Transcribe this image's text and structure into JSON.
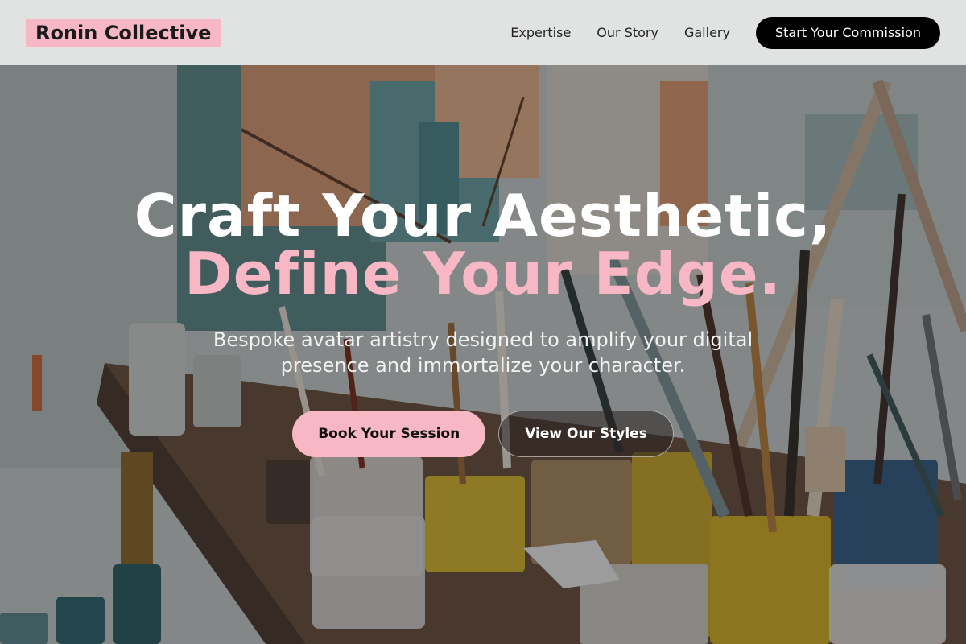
{
  "brand": {
    "name": "Ronin Collective"
  },
  "nav": {
    "links": [
      "Expertise",
      "Our Story",
      "Gallery"
    ],
    "cta_label": "Start Your Commission"
  },
  "hero": {
    "headline_line1": "Craft Your Aesthetic,",
    "headline_line2": "Define Your Edge.",
    "subtitle": "Bespoke avatar artistry designed to amplify your digital presence and immortalize your character.",
    "primary_button": "Book Your Session",
    "secondary_button": "View Our Styles"
  },
  "colors": {
    "accent": "#f7b7c4",
    "header_bg": "#eceeee",
    "cta_bg": "#000000",
    "headline": "#ffffff"
  }
}
